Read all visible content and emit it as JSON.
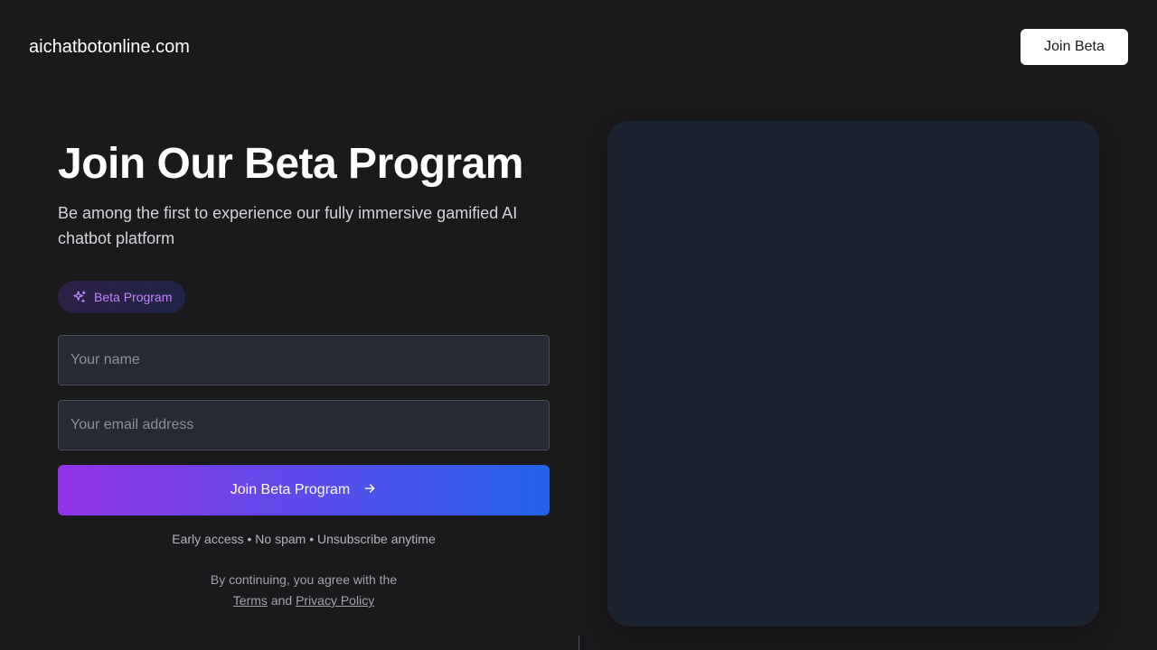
{
  "header": {
    "brand": "aichatbotonline.com",
    "cta_label": "Join Beta"
  },
  "hero": {
    "title": "Join Our Beta Program",
    "subtitle": "Be among the first to experience our fully immersive gamified AI chatbot platform",
    "badge": {
      "icon": "sparkles-icon",
      "label": "Beta Program"
    }
  },
  "form": {
    "name_placeholder": "Your name",
    "name_value": "",
    "email_placeholder": "Your email address",
    "email_value": "",
    "submit_label": "Join Beta Program",
    "submit_icon": "arrow-right-icon"
  },
  "notes": "Early access • No spam • Unsubscribe anytime",
  "legal": {
    "prefix": "By continuing, you agree with the",
    "terms_label": "Terms",
    "and": "and",
    "privacy_label": "Privacy Policy"
  },
  "colors": {
    "background": "#1a1a1d",
    "panel": "#1b2330",
    "accent_start": "#9333ea",
    "accent_end": "#2563eb",
    "badge_text": "#c084fc"
  }
}
